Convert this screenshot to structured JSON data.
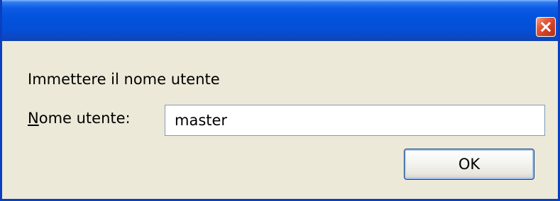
{
  "window": {
    "close_icon": "close-icon",
    "titlebar_color": "#0252db",
    "close_button_color": "#e2593b"
  },
  "dialog": {
    "prompt": "Immettere il nome utente",
    "field_label_mnemonic": "N",
    "field_label_rest": "ome utente:",
    "username_value": "master",
    "ok_label": "OK"
  }
}
